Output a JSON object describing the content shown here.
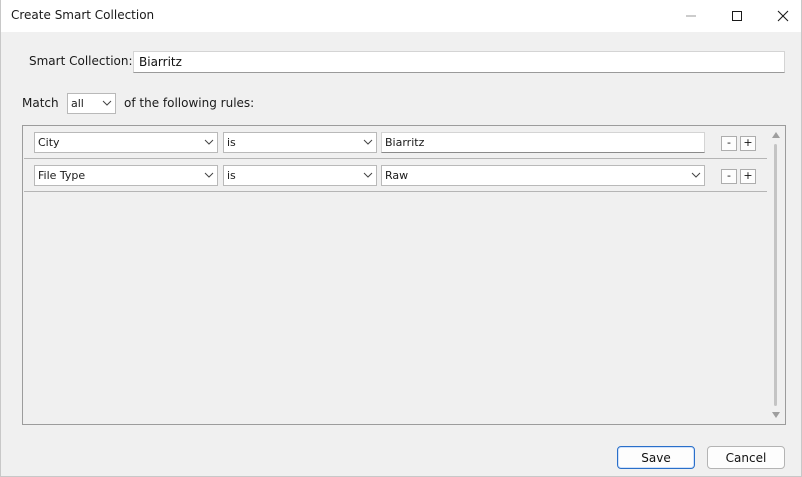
{
  "window": {
    "title": "Create Smart Collection"
  },
  "name_row": {
    "label": "Smart Collection:",
    "value": "Biarritz"
  },
  "match_row": {
    "label": "Match",
    "selected": "all",
    "suffix": "of the following rules:"
  },
  "rules": [
    {
      "attribute": "City",
      "operator": "is",
      "value": "Biarritz",
      "value_kind": "text"
    },
    {
      "attribute": "File Type",
      "operator": "is",
      "value": "Raw",
      "value_kind": "select"
    }
  ],
  "rule_buttons": {
    "remove": "-",
    "add": "+"
  },
  "footer": {
    "save_label": "Save",
    "cancel_label": "Cancel"
  },
  "icons": {
    "minimize": "minimize-icon",
    "maximize": "maximize-icon",
    "close": "close-icon",
    "dropdown": "chevron-down-icon"
  },
  "colors": {
    "accent": "#2a6fc9",
    "background": "#f0f0f0"
  }
}
